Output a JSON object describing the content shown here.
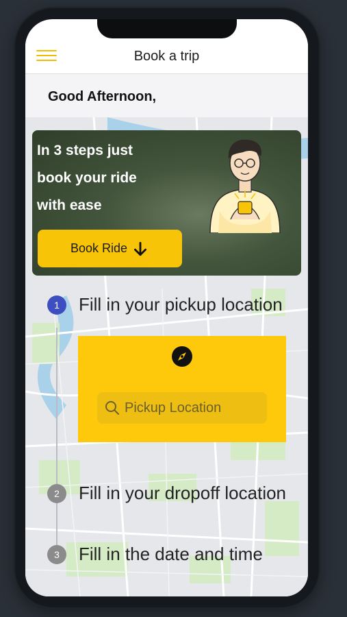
{
  "header": {
    "title": "Book a trip"
  },
  "greeting": "Good Afternoon,",
  "hero": {
    "lines": [
      "In 3 steps just",
      "book your ride",
      "with ease"
    ],
    "button_label": "Book Ride"
  },
  "steps": [
    {
      "number": "1",
      "label": "Fill in your pickup location",
      "active": true
    },
    {
      "number": "2",
      "label": "Fill in your dropoff location",
      "active": false
    },
    {
      "number": "3",
      "label": "Fill in the date and time",
      "active": false
    }
  ],
  "pickup": {
    "placeholder": "Pickup Location"
  },
  "icons": {
    "menu": "hamburger-menu-icon",
    "book": "arrow-down-icon",
    "locate": "compass-icon",
    "search": "search-icon"
  },
  "colors": {
    "accent": "#fdc90a",
    "step_active": "#3d4ec0",
    "step_inactive": "#8b8b8b",
    "background": "#2a3038"
  }
}
